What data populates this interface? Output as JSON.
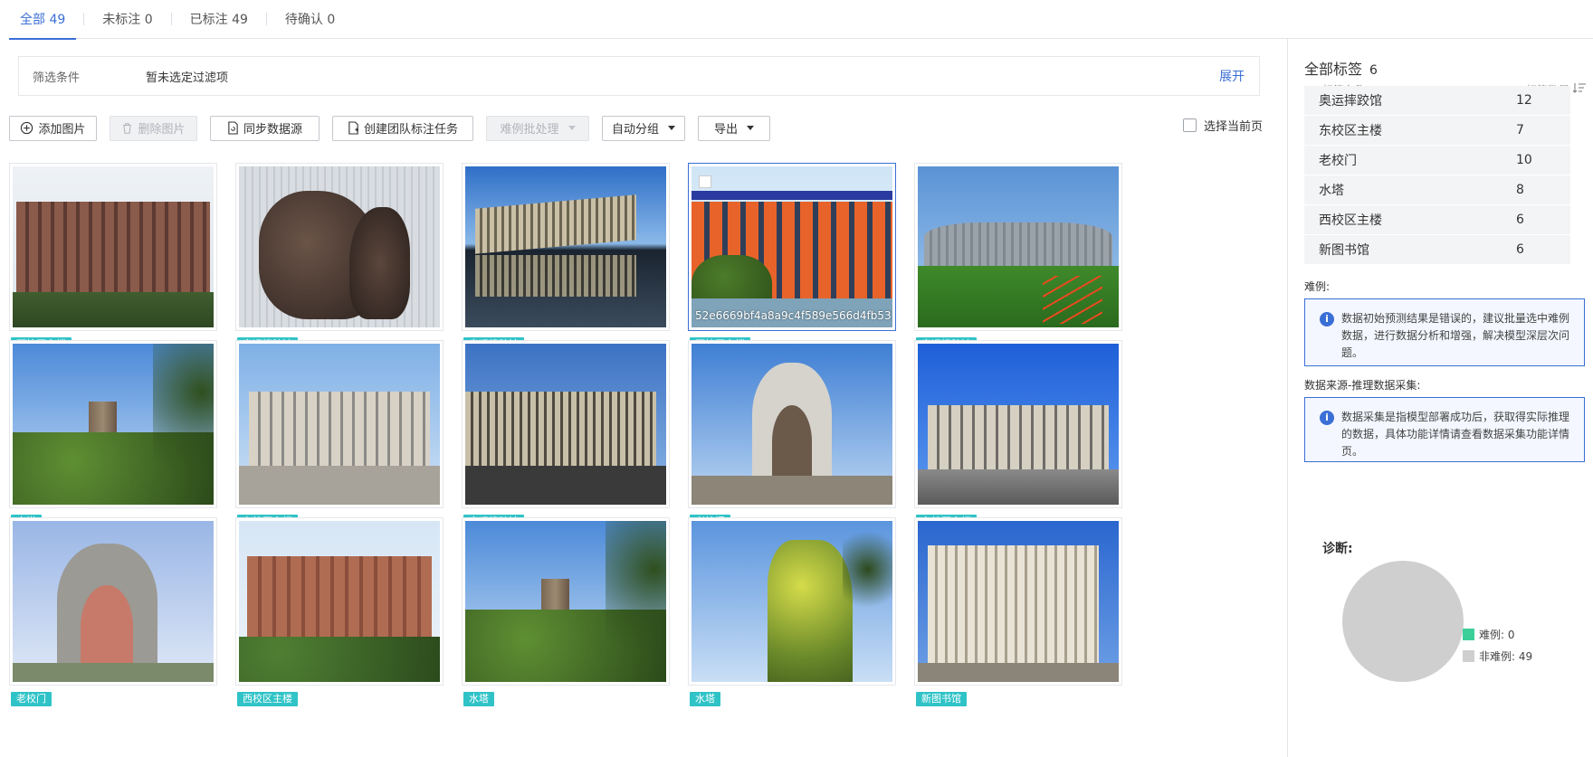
{
  "tabs": [
    {
      "label": "全部 49",
      "active": true
    },
    {
      "label": "未标注 0",
      "active": false
    },
    {
      "label": "已标注 49",
      "active": false
    },
    {
      "label": "待确认 0",
      "active": false
    }
  ],
  "filter": {
    "label": "筛选条件",
    "value": "暂未选定过滤项",
    "expand": "展开"
  },
  "toolbar": {
    "add_image": "添加图片",
    "delete_image": "删除图片",
    "sync_source": "同步数据源",
    "create_team_task": "创建团队标注任务",
    "hard_batch": "难例批处理",
    "auto_group": "自动分组",
    "export": "导出",
    "select_page": "选择当前页"
  },
  "images": [
    {
      "tag": "西校区主楼",
      "scene": "brick-building"
    },
    {
      "tag": "奥运摔跤馆",
      "scene": "statue"
    },
    {
      "tag": "奥运摔跤馆",
      "scene": "arena-reflect"
    },
    {
      "tag": "西校区主楼",
      "scene": "orange-building",
      "filename": "52e6669bf4a8a9c4f589e566d4fb5318.jpeg",
      "selected": true
    },
    {
      "tag": "奥运摔跤馆",
      "scene": "arena-grass"
    },
    {
      "tag": "水塔",
      "scene": "tower"
    },
    {
      "tag": "东校区主楼",
      "scene": "grey-building"
    },
    {
      "tag": "奥运摔跤馆",
      "scene": "arena-dark"
    },
    {
      "tag": "老校门",
      "scene": "gate"
    },
    {
      "tag": "东校区主楼",
      "scene": "grey-building-blue"
    },
    {
      "tag": "老校门",
      "scene": "gate2"
    },
    {
      "tag": "西校区主楼",
      "scene": "brick-building2"
    },
    {
      "tag": "水塔",
      "scene": "tower"
    },
    {
      "tag": "水塔",
      "scene": "tower-close"
    },
    {
      "tag": "新图书馆",
      "scene": "library"
    }
  ],
  "panel": {
    "title": "全部标签",
    "count": "6",
    "col_name": "标签名称",
    "col_count": "标签数量",
    "labels": [
      {
        "name": "奥运摔跤馆",
        "count": "12"
      },
      {
        "name": "东校区主楼",
        "count": "7"
      },
      {
        "name": "老校门",
        "count": "10"
      },
      {
        "name": "水塔",
        "count": "8"
      },
      {
        "name": "西校区主楼",
        "count": "6"
      },
      {
        "name": "新图书馆",
        "count": "6"
      }
    ],
    "hard_title": "难例:",
    "hard_info": "数据初始预测结果是错误的，建议批量选中难例数据，进行数据分析和增强，解决模型深层次问题。",
    "source_title": "数据来源-推理数据采集:",
    "source_info": "数据采集是指模型部署成功后，获取得实际推理的数据，具体功能详情请查看数据采集功能详情页。",
    "diag_title": "诊断:",
    "legend": [
      {
        "label": "难例: 0",
        "color": "#3ccf9a"
      },
      {
        "label": "非难例: 49",
        "color": "#cfcfcf"
      }
    ]
  },
  "chart_data": {
    "type": "pie",
    "categories": [
      "难例",
      "非难例"
    ],
    "values": [
      0,
      49
    ],
    "title": "诊断:"
  }
}
